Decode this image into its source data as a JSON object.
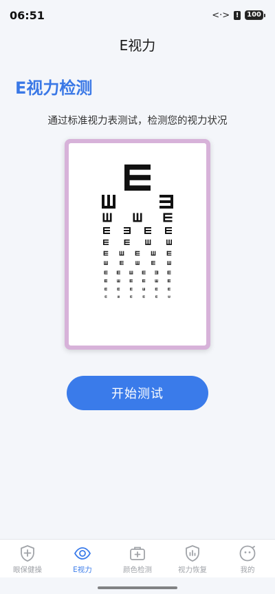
{
  "status": {
    "time": "06:51",
    "battery": "100"
  },
  "header": {
    "title": "E视力"
  },
  "main": {
    "section_title": "E视力检测",
    "subtitle": "通过标准视力表测试，检测您的视力状况",
    "start_button": "开始测试"
  },
  "colors": {
    "accent": "#3a7bea",
    "chart_border": "#d7b2d9",
    "inactive_tab": "#a0a3a8"
  },
  "tabs": [
    {
      "label": "眼保健操",
      "icon": "shield-plus-icon",
      "active": false
    },
    {
      "label": "E视力",
      "icon": "eye-icon",
      "active": true
    },
    {
      "label": "颜色检测",
      "icon": "medical-kit-icon",
      "active": false
    },
    {
      "label": "视力恢复",
      "icon": "bar-chart-icon",
      "active": false
    },
    {
      "label": "我的",
      "icon": "smiley-icon",
      "active": false
    }
  ]
}
